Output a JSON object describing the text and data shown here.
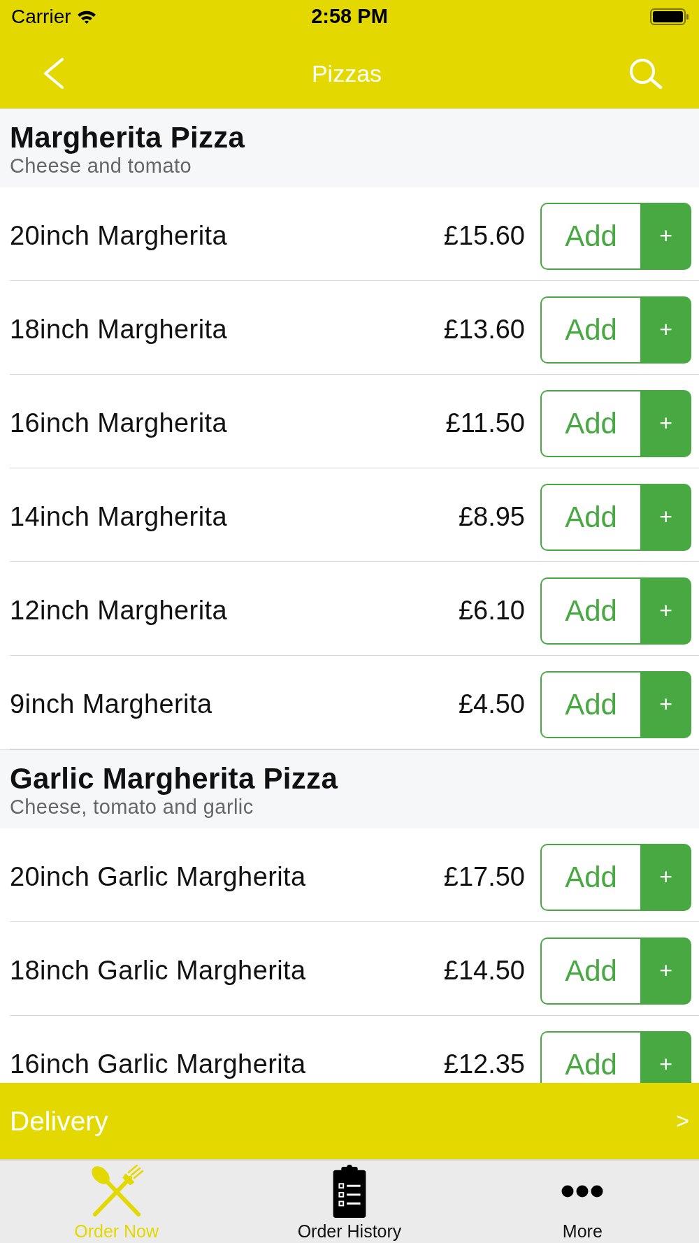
{
  "status_bar": {
    "carrier": "Carrier",
    "time": "2:58 PM"
  },
  "nav_bar": {
    "title": "Pizzas"
  },
  "sections": [
    {
      "title": "Margherita Pizza",
      "subtitle": "Cheese and tomato",
      "items": [
        {
          "name": "20inch Margherita",
          "price": "£15.60",
          "button": "Add",
          "plus": "+"
        },
        {
          "name": "18inch Margherita",
          "price": "£13.60",
          "button": "Add",
          "plus": "+"
        },
        {
          "name": "16inch Margherita",
          "price": "£11.50",
          "button": "Add",
          "plus": "+"
        },
        {
          "name": "14inch Margherita",
          "price": "£8.95",
          "button": "Add",
          "plus": "+"
        },
        {
          "name": "12inch Margherita",
          "price": "£6.10",
          "button": "Add",
          "plus": "+"
        },
        {
          "name": "9inch Margherita",
          "price": "£4.50",
          "button": "Add",
          "plus": "+"
        }
      ]
    },
    {
      "title": "Garlic Margherita Pizza",
      "subtitle": "Cheese, tomato and garlic",
      "items": [
        {
          "name": "20inch Garlic Margherita",
          "price": "£17.50",
          "button": "Add",
          "plus": "+"
        },
        {
          "name": "18inch Garlic Margherita",
          "price": "£14.50",
          "button": "Add",
          "plus": "+"
        },
        {
          "name": "16inch Garlic Margherita",
          "price": "£12.35",
          "button": "Add",
          "plus": "+"
        }
      ]
    }
  ],
  "delivery_bar": {
    "label": "Delivery",
    "chevron": ">"
  },
  "tab_bar": [
    {
      "label": "Order Now",
      "kind": "cutlery",
      "selected": true
    },
    {
      "label": "Order History",
      "kind": "clipboard",
      "selected": false
    },
    {
      "label": "More",
      "kind": "dots",
      "selected": false
    }
  ]
}
